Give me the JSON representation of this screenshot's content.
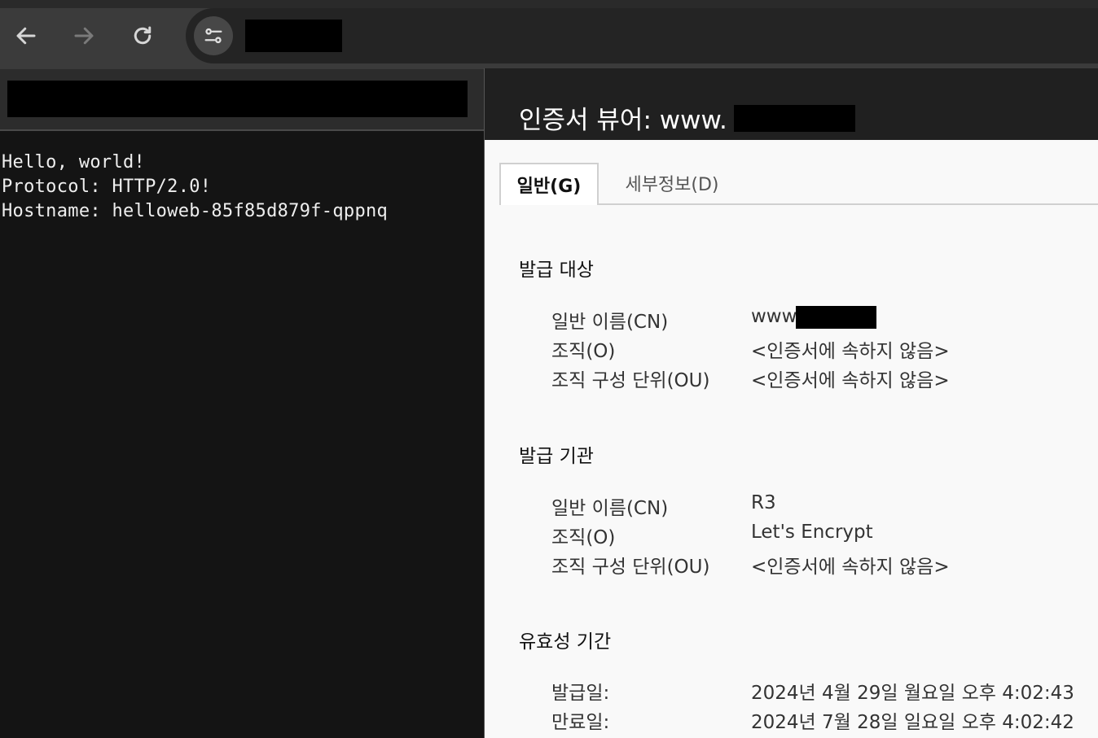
{
  "browser": {
    "back_icon": "arrow-left-icon",
    "forward_icon": "arrow-right-icon",
    "reload_icon": "reload-icon",
    "site_info_icon": "tune-icon"
  },
  "page": {
    "lines": [
      "Hello, world!",
      "Protocol: HTTP/2.0!",
      "Hostname: helloweb-85f85d879f-qppnq"
    ]
  },
  "cert_viewer": {
    "title": "인증서 뷰어: www.",
    "tabs": {
      "general": "일반(G)",
      "details": "세부정보(D)"
    },
    "issued_to": {
      "title": "발급 대상",
      "cn_label": "일반 이름(CN)",
      "cn_value": "www.",
      "o_label": "조직(O)",
      "o_value": "<인증서에 속하지 않음>",
      "ou_label": "조직 구성 단위(OU)",
      "ou_value": "<인증서에 속하지 않음>"
    },
    "issued_by": {
      "title": "발급 기관",
      "cn_label": "일반 이름(CN)",
      "cn_value": "R3",
      "o_label": "조직(O)",
      "o_value": "Let's Encrypt",
      "ou_label": "조직 구성 단위(OU)",
      "ou_value": "<인증서에 속하지 않음>"
    },
    "validity": {
      "title": "유효성 기간",
      "issued_label": "발급일:",
      "issued_value": "2024년 4월 29일 월요일 오후 4:02:43",
      "expires_label": "만료일:",
      "expires_value": "2024년 7월 28일 일요일 오후 4:02:42"
    }
  },
  "colors": {
    "toolbar": "#3b3b3b",
    "omnibox": "#242424",
    "page_bg": "#141414",
    "dialog_bg": "#f9f9f9",
    "titlebar": "#202020"
  }
}
